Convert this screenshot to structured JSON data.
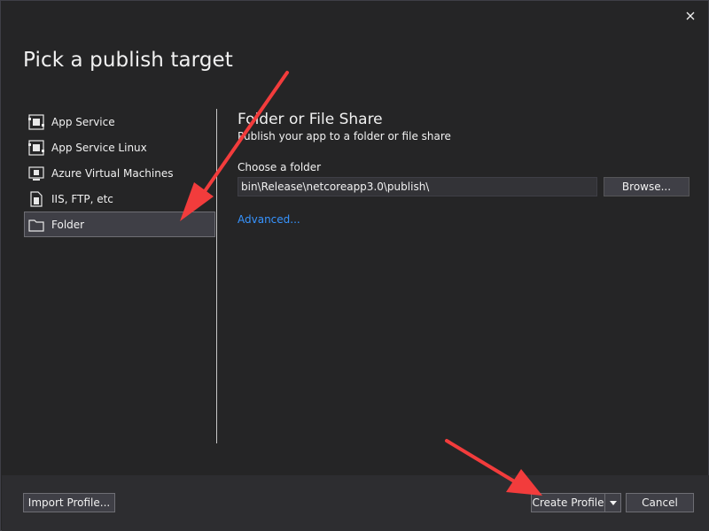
{
  "dialog": {
    "title": "Pick a publish target",
    "close_icon": "close-icon"
  },
  "targets": [
    {
      "label": "App Service",
      "icon": "app-service-icon"
    },
    {
      "label": "App Service Linux",
      "icon": "app-service-linux-icon"
    },
    {
      "label": "Azure Virtual Machines",
      "icon": "virtual-machine-icon"
    },
    {
      "label": "IIS, FTP, etc",
      "icon": "iis-ftp-icon"
    },
    {
      "label": "Folder",
      "icon": "folder-icon",
      "selected": true
    }
  ],
  "detail": {
    "title": "Folder or File Share",
    "subtitle": "Publish your app to a folder or file share",
    "folder_label": "Choose a folder",
    "folder_value": "bin\\Release\\netcoreapp3.0\\publish\\",
    "browse_label": "Browse...",
    "advanced_label": "Advanced..."
  },
  "footer": {
    "import_label": "Import Profile...",
    "create_label": "Create Profile",
    "cancel_label": "Cancel"
  },
  "colors": {
    "background": "#252526",
    "footer": "#2d2d30",
    "link": "#3794ff",
    "annotation_arrow": "#f23c3c"
  }
}
